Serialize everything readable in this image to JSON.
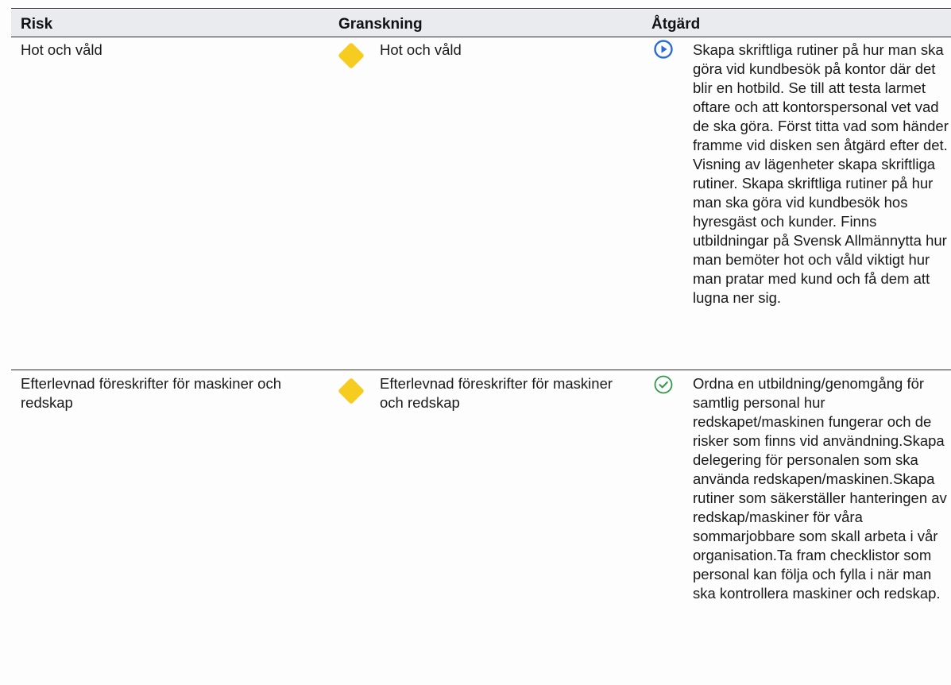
{
  "table": {
    "headers": {
      "risk": "Risk",
      "granskning": "Granskning",
      "atgard": "Åtgärd"
    },
    "rows": [
      {
        "risk": "Hot och våld",
        "granskning": "Hot och våld",
        "granskning_level_color": "#f5cc1f",
        "atgard_status_icon": "play-icon",
        "atgard_status_color": "#2a6bd6",
        "atgard": "Skapa skriftliga rutiner på hur man ska göra vid kundbesök på kontor där det blir en hotbild. Se till att testa larmet oftare och att kontorspersonal vet vad de ska göra. Först titta vad som händer framme vid disken sen åtgärd efter det. Visning av lägenheter skapa skriftliga rutiner. Skapa skriftliga rutiner på hur man ska göra vid kundbesök hos hyresgäst och kunder. Finns utbildningar på Svensk Allmännytta hur man bemöter hot och våld viktigt hur man pratar med kund och få dem att lugna ner sig."
      },
      {
        "risk": "Efterlevnad föreskrifter för maskiner och redskap",
        "granskning": "Efterlevnad föreskrifter för maskiner och redskap",
        "granskning_level_color": "#f5cc1f",
        "atgard_status_icon": "check-circle-icon",
        "atgard_status_color": "#2e9a4a",
        "atgard": "Ordna en utbildning/genomgång för samtlig personal hur redskapet/maskinen fungerar och de risker som finns vid användning.Skapa delegering för personalen som ska använda redskapen/maskinen.Skapa rutiner som säkerställer hanteringen av redskap/maskiner för våra sommarjobbare som skall arbeta i vår organisation.Ta fram checklistor som personal kan följa och fylla i när man ska kontrollera maskiner och redskap."
      }
    ]
  }
}
